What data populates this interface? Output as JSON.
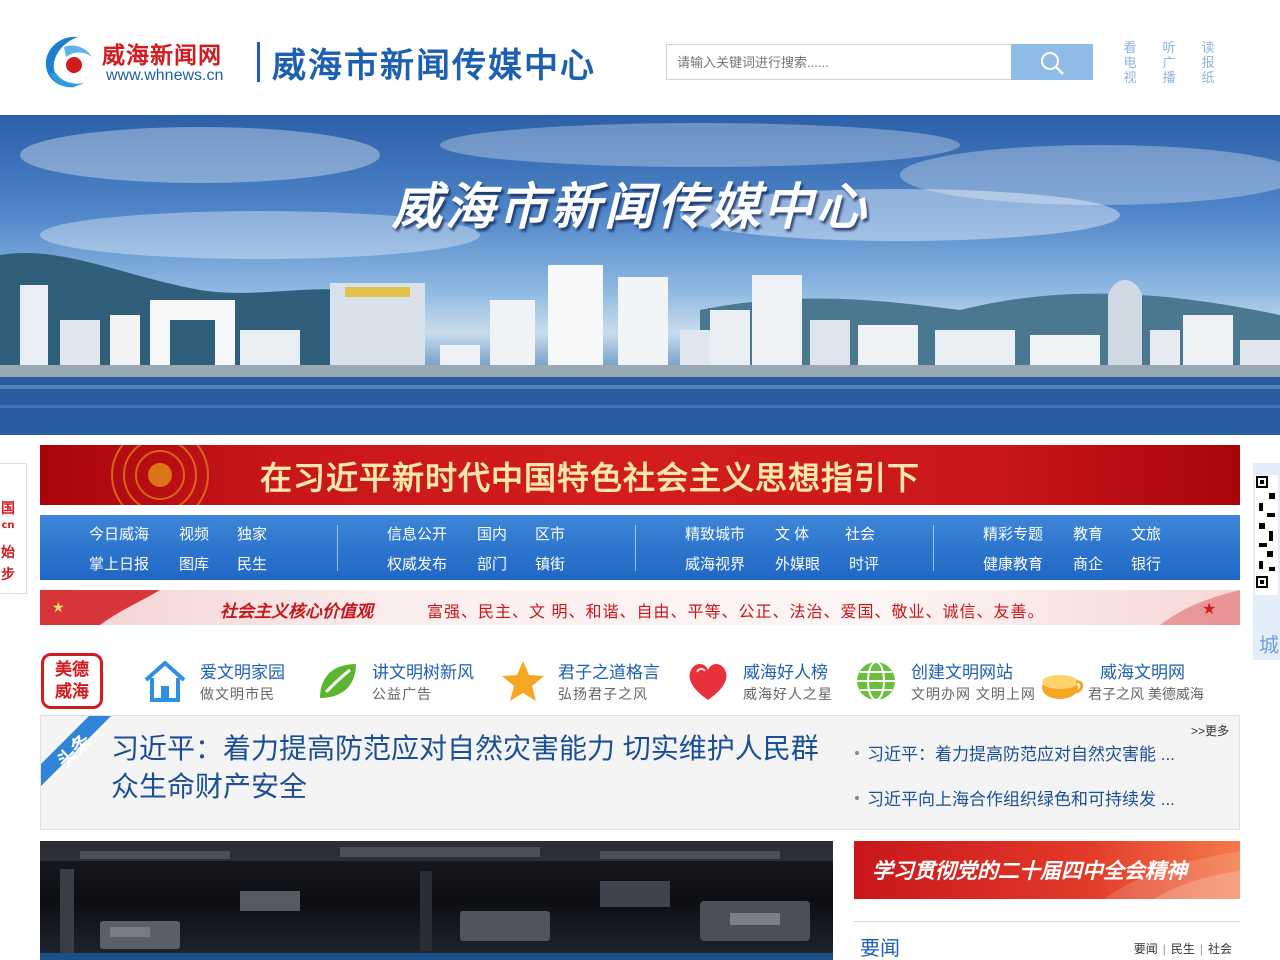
{
  "header": {
    "logo_cn": "威海新闻网",
    "logo_url": "www.whnews.cn",
    "center_name": "威海市新闻传媒中心",
    "search_placeholder": "请输入关键词进行搜索......",
    "media_links": [
      "看电视",
      "听广播",
      "读报纸"
    ]
  },
  "banner": {
    "title": "威海市新闻传媒中心"
  },
  "side_left": {
    "chars": [
      "国",
      "cn",
      "始",
      "步"
    ]
  },
  "slogan": {
    "text": "在习近平新时代中国特色社会主义思想指引下"
  },
  "nav": {
    "groups": [
      [
        [
          "今日威海",
          "视频",
          "独家"
        ],
        [
          "掌上日报",
          "图库",
          "民生"
        ]
      ],
      [
        [
          "信息公开",
          "国内",
          "区市"
        ],
        [
          "权威发布",
          "部门",
          "镇街"
        ]
      ],
      [
        [
          "精致城市",
          "文 体",
          "社会"
        ],
        [
          "威海视界",
          "外媒眼",
          "时评"
        ]
      ],
      [
        [
          "精彩专题",
          "教育",
          "文旅"
        ],
        [
          "健康教育",
          "商企",
          "银行"
        ]
      ]
    ]
  },
  "values": {
    "title": "社会主义核心价值观",
    "text": "富强、民主、文 明、和谐、自由、平等、公正、法治、爱国、敬业、诚信、友善。"
  },
  "civilization": {
    "badge": [
      "美德",
      "威海"
    ],
    "items": [
      {
        "title": "爱文明家园",
        "sub": "做文明市民",
        "icon": "house-icon"
      },
      {
        "title": "讲文明树新风",
        "sub": "公益广告",
        "icon": "leaf-icon"
      },
      {
        "title": "君子之道格言",
        "sub": "弘扬君子之风",
        "icon": "star-icon"
      },
      {
        "title": "威海好人榜",
        "sub": "威海好人之星",
        "icon": "heart-icon"
      },
      {
        "title": "创建文明网站",
        "sub": "文明办网 文明上网",
        "icon": "globe-icon"
      },
      {
        "title": "威海文明网",
        "sub": "君子之风 美德威海",
        "icon": "cup-icon"
      }
    ]
  },
  "headline": {
    "tag": "头条",
    "main": "习近平：着力提高防范应对自然灾害能力 切实维护人民群众生命财产安全",
    "more": ">>更多",
    "side": [
      "习近平：着力提高防范应对自然灾害能 ...",
      "习近平向上海合作组织绿色和可持续发 ..."
    ]
  },
  "right_col": {
    "study_banner": "学习贯彻党的二十届四中全会精神",
    "news_title": "要闻",
    "news_tabs": [
      "要闻",
      "民生",
      "社会"
    ]
  },
  "right_float": {
    "label": "城"
  },
  "colors": {
    "brand_blue": "#1d5fb0",
    "brand_red": "#d21a1f",
    "nav_blue": "#2a74cf"
  }
}
